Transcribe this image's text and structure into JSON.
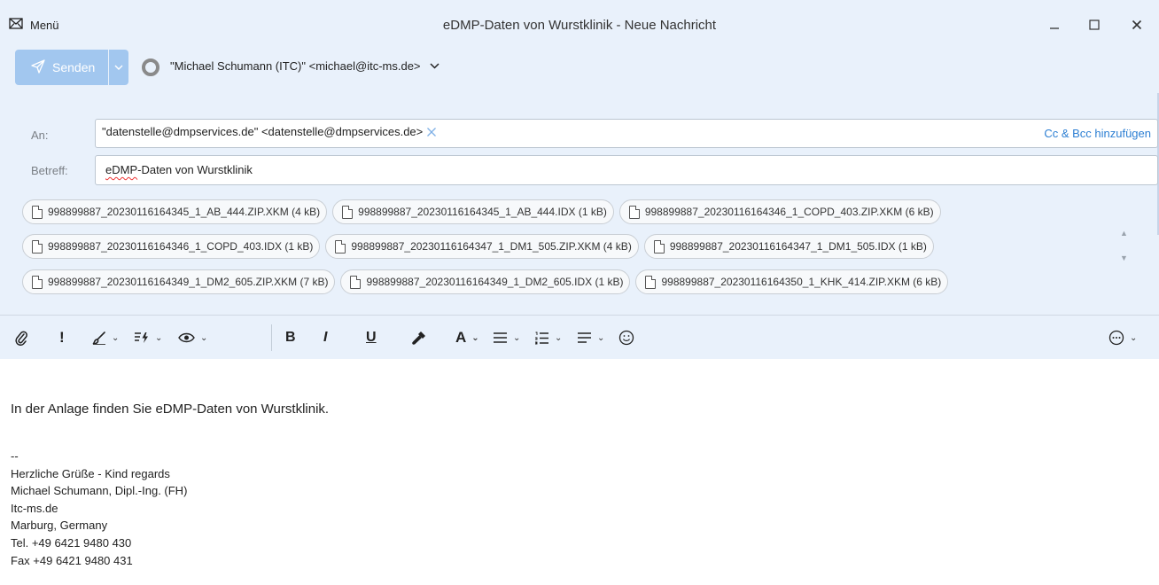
{
  "window": {
    "title": "eDMP-Daten von Wurstklinik - Neue Nachricht",
    "menu_label": "Menü"
  },
  "compose": {
    "send_label": "Senden",
    "sender": "\"Michael Schumann (ITC)\" <michael@itc-ms.de>",
    "to_label": "An:",
    "to_recipient": "\"datenstelle@dmpservices.de\" <datenstelle@dmpservices.de>",
    "cc_bcc_link": "Cc & Bcc hinzufügen",
    "subject_label": "Betreff:",
    "subject_prefix": "eDMP",
    "subject_rest": "-Daten von Wurstklinik"
  },
  "attachments": [
    "998899887_20230116164345_1_AB_444.ZIP.XKM (4 kB)",
    "998899887_20230116164345_1_AB_444.IDX (1 kB)",
    "998899887_20230116164346_1_COPD_403.ZIP.XKM (6 kB)",
    "998899887_20230116164346_1_COPD_403.IDX (1 kB)",
    "998899887_20230116164347_1_DM1_505.ZIP.XKM (4 kB)",
    "998899887_20230116164347_1_DM1_505.IDX (1 kB)",
    "998899887_20230116164349_1_DM2_605.ZIP.XKM (7 kB)",
    "998899887_20230116164349_1_DM2_605.IDX (1 kB)",
    "998899887_20230116164350_1_KHK_414.ZIP.XKM (6 kB)"
  ],
  "format_toolbar": {
    "importance": "!",
    "bold": "B",
    "italic": "I",
    "underline": "U",
    "font_color": "A"
  },
  "message": {
    "body": "In der Anlage finden Sie eDMP-Daten von Wurstklinik.",
    "signature": [
      "--",
      "Herzliche Grüße - Kind regards",
      "Michael Schumann, Dipl.-Ing. (FH)",
      "Itc-ms.de",
      "Marburg, Germany",
      "Tel. +49 6421 9480 430",
      "Fax +49 6421 9480 431"
    ]
  },
  "colors": {
    "chrome_background": "#e9f1fb",
    "send_button": "#a2c7ef",
    "link": "#2d7fd3"
  },
  "icons": [
    "mail-icon",
    "minimize-icon",
    "maximize-icon",
    "close-icon",
    "send-icon",
    "chevron-down-icon",
    "status-circle-icon",
    "remove-recipient-icon",
    "file-icon",
    "paperclip-icon",
    "brush-icon",
    "quick-parts-icon",
    "eye-icon",
    "format-painter-icon",
    "bullet-list-icon",
    "numbered-list-icon",
    "align-icon",
    "emoji-icon",
    "more-options-icon"
  ]
}
